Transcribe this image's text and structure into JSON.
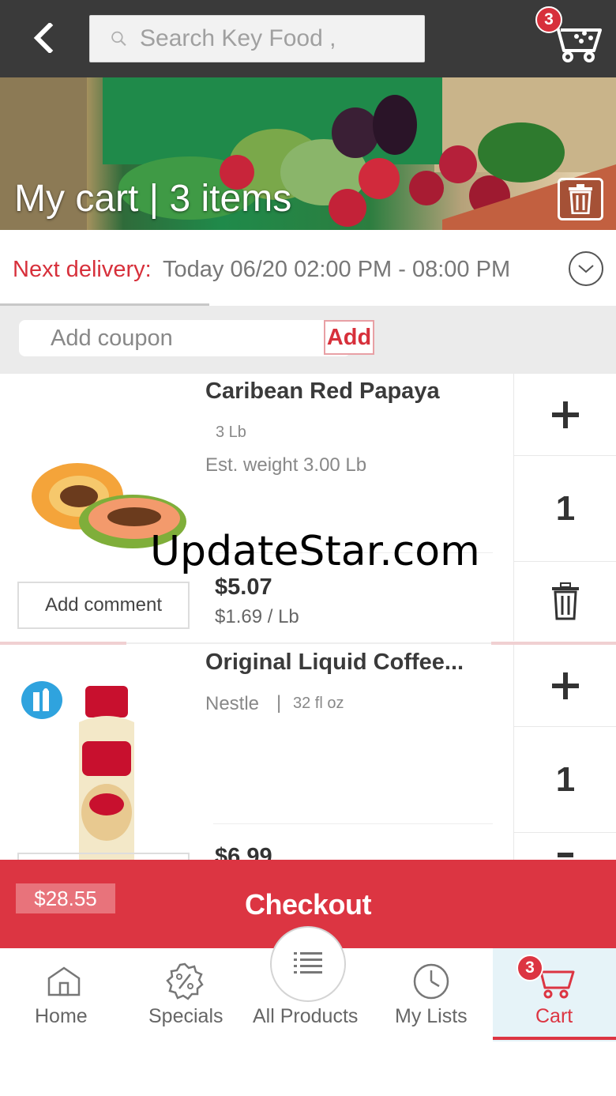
{
  "header": {
    "search_placeholder": "Search Key Food ,",
    "cart_count": "3"
  },
  "banner": {
    "title": "My cart | 3 items"
  },
  "delivery": {
    "label": "Next delivery:",
    "value": " Today 06/20 02:00 PM - 08:00 PM"
  },
  "coupon": {
    "placeholder": "Add coupon",
    "add_label": "Add"
  },
  "items": [
    {
      "name": "Caribean Red Papaya",
      "size": "3 Lb",
      "est_weight": "Est. weight 3.00 Lb",
      "quantity": "1",
      "price": "$5.07",
      "unit_price": "$1.69 / Lb",
      "comment_label": "Add comment"
    },
    {
      "name": "Original Liquid Coffee...",
      "brand": "Nestle",
      "separator": "|",
      "size": "32 fl oz",
      "quantity": "1",
      "price": "$6.99"
    }
  ],
  "watermark": "UpdateStar.com",
  "checkout": {
    "total": "$28.55",
    "label": "Checkout"
  },
  "nav": {
    "home": "Home",
    "specials": "Specials",
    "all_products": "All Products",
    "my_lists": "My Lists",
    "cart": "Cart",
    "cart_count": "3",
    "active": "cart"
  },
  "colors": {
    "brand_red": "#dc3542",
    "topbar": "#3a3a3a",
    "cart_nav_highlight": "#e6f3f8"
  },
  "icons": [
    "back-arrow-icon",
    "search-icon",
    "cart-icon",
    "trash-icon",
    "chevron-down-icon",
    "plus-icon",
    "home-icon",
    "specials-badge-icon",
    "list-icon",
    "clock-icon"
  ]
}
